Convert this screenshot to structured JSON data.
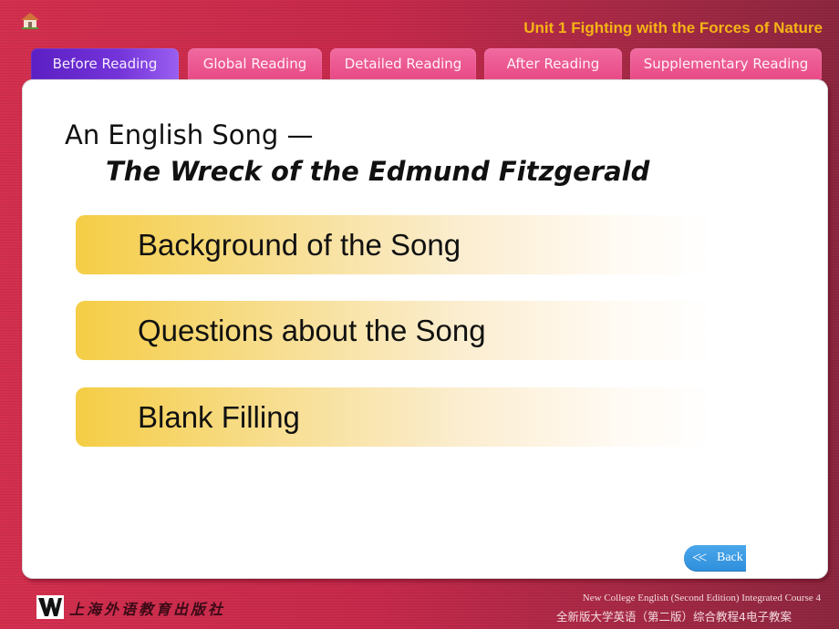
{
  "header": {
    "home_icon": "home-icon",
    "unit_title": "Unit 1 Fighting with the Forces of Nature"
  },
  "tabs": [
    {
      "label": "Before Reading",
      "active": true
    },
    {
      "label": "Global Reading",
      "active": false
    },
    {
      "label": "Detailed Reading",
      "active": false
    },
    {
      "label": "After Reading",
      "active": false
    },
    {
      "label": "Supplementary Reading",
      "active": false
    }
  ],
  "main": {
    "heading_line1": "An English Song —",
    "heading_line2": "The Wreck of the Edmund Fitzgerald",
    "menu_items": [
      {
        "label": "Background of the Song"
      },
      {
        "label": "Questions about the Song"
      },
      {
        "label": "Blank Filling"
      }
    ],
    "back_button": {
      "icon": "double-chevron-left-icon",
      "label": "Back"
    }
  },
  "footer": {
    "publisher_logo": "W",
    "publisher_name_cn": "上海外语教育出版社",
    "course_en": "New College English (Second Edition) Integrated Course 4",
    "course_cn": "全新版大学英语（第二版）综合教程4电子教案"
  }
}
